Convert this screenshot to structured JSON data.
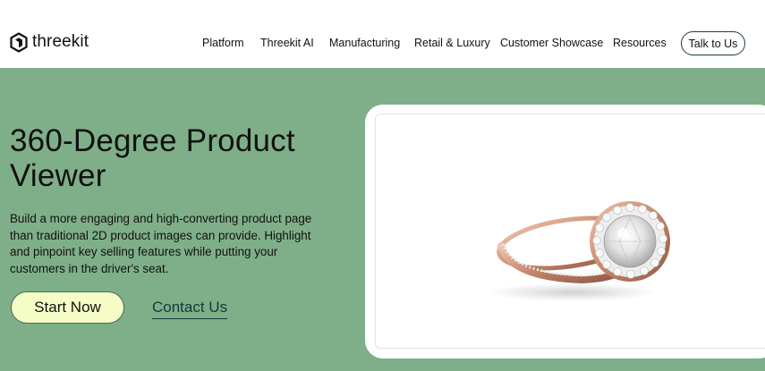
{
  "brand": {
    "name": "threekit"
  },
  "nav": {
    "items": [
      {
        "label": "Platform"
      },
      {
        "label": "Threekit AI"
      },
      {
        "label": "Manufacturing"
      },
      {
        "label": "Retail & Luxury"
      },
      {
        "label": "Customer Showcase"
      },
      {
        "label": "Resources"
      }
    ],
    "cta_label": "Talk to Us"
  },
  "hero": {
    "title": "360-Degree Product Viewer",
    "description": "Build a more engaging and high-converting product page than traditional 2D product images can provide. Highlight and pinpoint key selling features while putting your customers in the driver's seat.",
    "primary_button": "Start Now",
    "secondary_link": "Contact Us"
  },
  "viewer": {
    "product_icon": "diamond-ring-image"
  },
  "colors": {
    "hero_background": "#7faf88",
    "primary_button_bg": "#f5fcc6",
    "link_color": "#14383a",
    "cta_border": "#1f3f3a"
  }
}
